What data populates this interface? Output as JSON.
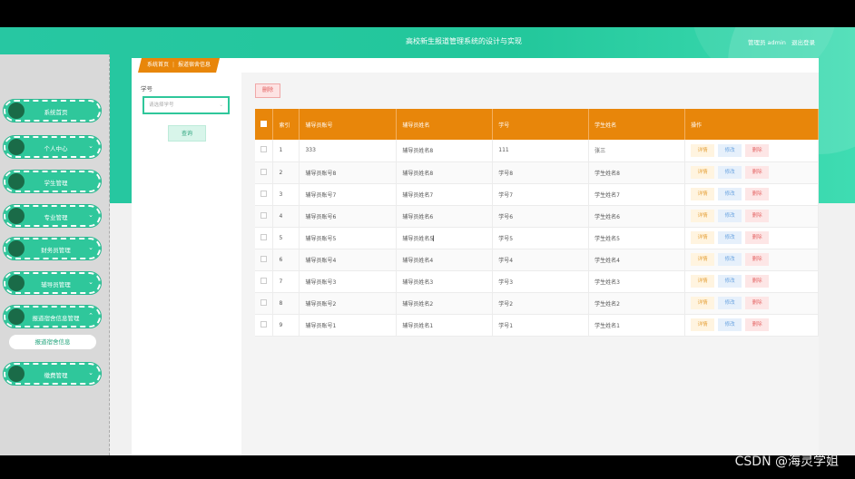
{
  "header": {
    "title": "高校新生报道管理系统的设计与实现",
    "user_role": "管理员 admin",
    "logout": "退出登录"
  },
  "sidebar": {
    "items": [
      {
        "label": "系统首页",
        "has_chevron": false
      },
      {
        "label": "个人中心",
        "has_chevron": true
      },
      {
        "label": "学生管理",
        "has_chevron": false
      },
      {
        "label": "专业管理",
        "has_chevron": true
      },
      {
        "label": "财务员管理",
        "has_chevron": true
      },
      {
        "label": "辅导员管理",
        "has_chevron": true
      },
      {
        "label": "报道宿舍信息管理",
        "has_chevron": true
      },
      {
        "label": "缴费管理",
        "has_chevron": true
      }
    ],
    "subitem": "报道宿舍信息"
  },
  "breadcrumb": {
    "home": "系统首页",
    "separator": "|",
    "current": "报道宿舍信息"
  },
  "search": {
    "label": "学号",
    "placeholder": "请选择学号",
    "query_button": "查询"
  },
  "toolbar": {
    "delete_label": "删除"
  },
  "table": {
    "headers": [
      "索引",
      "辅导员账号",
      "辅导员姓名",
      "学号",
      "学生姓名",
      "操作"
    ],
    "rows": [
      {
        "idx": "1",
        "a": "333",
        "b": "辅导员姓名8",
        "c": "111",
        "d": "张三"
      },
      {
        "idx": "2",
        "a": "辅导员账号8",
        "b": "辅导员姓名8",
        "c": "学号8",
        "d": "学生姓名8"
      },
      {
        "idx": "3",
        "a": "辅导员账号7",
        "b": "辅导员姓名7",
        "c": "学号7",
        "d": "学生姓名7"
      },
      {
        "idx": "4",
        "a": "辅导员账号6",
        "b": "辅导员姓名6",
        "c": "学号6",
        "d": "学生姓名6"
      },
      {
        "idx": "5",
        "a": "辅导员账号5",
        "b": "辅导员姓名5",
        "c": "学号5",
        "d": "学生姓名5"
      },
      {
        "idx": "6",
        "a": "辅导员账号4",
        "b": "辅导员姓名4",
        "c": "学号4",
        "d": "学生姓名4"
      },
      {
        "idx": "7",
        "a": "辅导员账号3",
        "b": "辅导员姓名3",
        "c": "学号3",
        "d": "学生姓名3"
      },
      {
        "idx": "8",
        "a": "辅导员账号2",
        "b": "辅导员姓名2",
        "c": "学号2",
        "d": "学生姓名2"
      },
      {
        "idx": "9",
        "a": "辅导员账号1",
        "b": "辅导员姓名1",
        "c": "学号1",
        "d": "学生姓名1"
      }
    ],
    "ops": {
      "detail": "详情",
      "edit": "修改",
      "delete": "删除"
    }
  },
  "watermark": "CSDN @海灵学姐",
  "colors": {
    "primary": "#2fc79b",
    "header_accent": "#e8860a",
    "sidebar_dot": "#1a6b48"
  }
}
